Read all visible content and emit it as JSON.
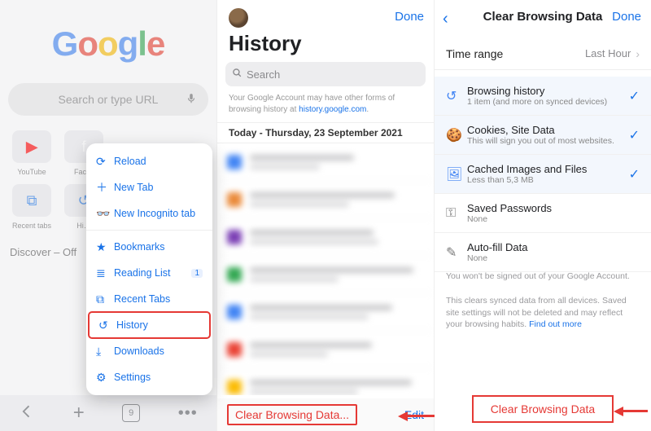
{
  "panel1": {
    "logo": {
      "g1": "G",
      "o1": "o",
      "o2": "o",
      "g2": "g",
      "l": "l",
      "e": "e"
    },
    "search_placeholder": "Search or type URL",
    "tiles": [
      {
        "label": "YouTube"
      },
      {
        "label": "Fac…"
      }
    ],
    "tiles2": [
      {
        "label": "Recent tabs"
      },
      {
        "label": "Hi…"
      }
    ],
    "discover": "Discover – Off",
    "tab_count": "9",
    "menu": {
      "reload": "Reload",
      "new_tab": "New Tab",
      "new_incognito": "New Incognito tab",
      "bookmarks": "Bookmarks",
      "reading_list": "Reading List",
      "reading_badge": "1",
      "recent_tabs": "Recent Tabs",
      "history": "History",
      "downloads": "Downloads",
      "settings": "Settings"
    }
  },
  "panel2": {
    "done": "Done",
    "title": "History",
    "search_placeholder": "Search",
    "note_a": "Your Google Account may have other forms of browsing history at ",
    "note_link": "history.google.com",
    "note_b": ".",
    "date_header": "Today - Thursday, 23 September 2021",
    "clear": "Clear Browsing Data...",
    "edit": "Edit",
    "items_favicon_colors": [
      "#4285F4",
      "#ea8a3a",
      "#7b3fb5",
      "#34A853",
      "#4285F4",
      "#ea4335",
      "#fbbc05"
    ]
  },
  "panel3": {
    "title": "Clear Browsing Data",
    "done": "Done",
    "time_label": "Time range",
    "time_value": "Last Hour",
    "opts": {
      "browsing": {
        "title": "Browsing history",
        "sub": "1 item (and more on synced devices)"
      },
      "cookies": {
        "title": "Cookies, Site Data",
        "sub": "This will sign you out of most websites."
      },
      "cached": {
        "title": "Cached Images and Files",
        "sub": "Less than 5,3 MB"
      },
      "passwords": {
        "title": "Saved Passwords",
        "sub": "None"
      },
      "autofill": {
        "title": "Auto-fill Data",
        "sub": "None"
      }
    },
    "info1": "You won't be signed out of your Google Account.",
    "info2a": "This clears synced data from all devices. Saved site settings will not be deleted and may reflect your browsing habits. ",
    "info2link": "Find out more",
    "button": "Clear Browsing Data"
  }
}
